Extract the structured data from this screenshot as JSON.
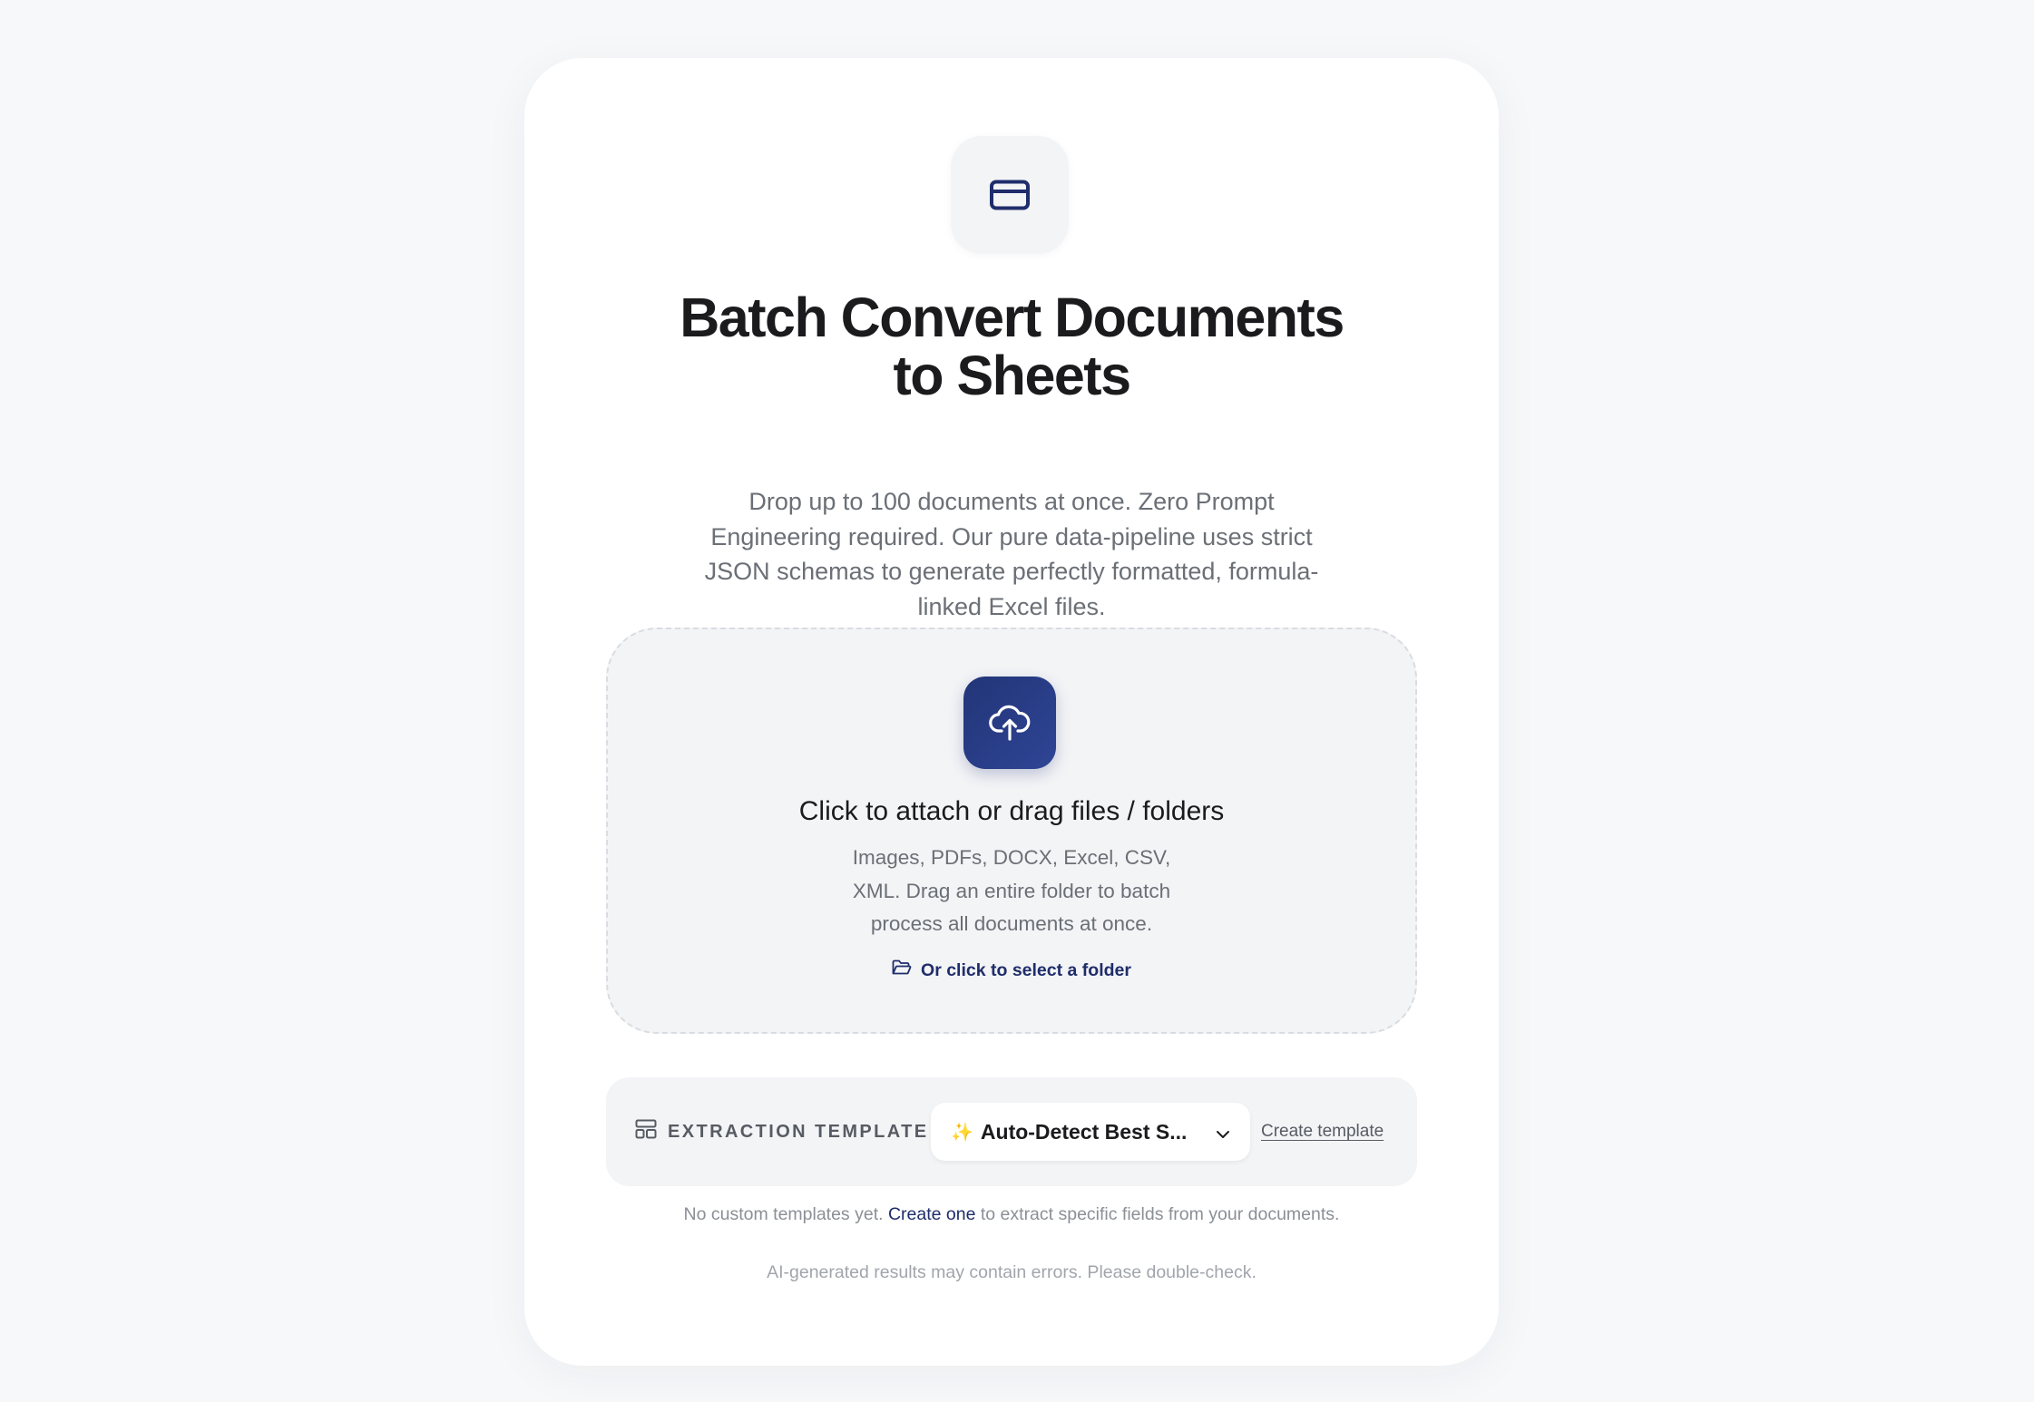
{
  "hero": {
    "icon": "credit-card-icon",
    "title_line1": "Batch Convert Documents",
    "title_line2": "to Sheets",
    "subtitle": "Drop up to 100 documents at once. Zero Prompt Engineering required. Our pure data-pipeline uses strict JSON schemas to generate perfectly formatted, formula-linked Excel files."
  },
  "dropzone": {
    "icon": "cloud-upload-icon",
    "title": "Click to attach or drag files / folders",
    "description": "Images, PDFs, DOCX, Excel, CSV, XML. Drag an entire folder to batch process all documents at once.",
    "folder_link": "Or click to select a folder",
    "folder_icon": "folder-open-icon"
  },
  "template": {
    "label": "EXTRACTION TEMPLATE",
    "label_icon": "layout-template-icon",
    "selected_prefix": "✨",
    "selected": "Auto-Detect Best S...",
    "create_link": "Create template"
  },
  "note": {
    "before": "No custom templates yet.",
    "link": "Create one",
    "after": "to extract specific fields from your documents."
  },
  "disclaimer": "AI-generated results may contain errors. Please double-check.",
  "colors": {
    "background": "#f7f8fa",
    "card": "#ffffff",
    "accent": "#223578",
    "link": "#1f2d6b",
    "muted_text": "#6b6f76"
  }
}
